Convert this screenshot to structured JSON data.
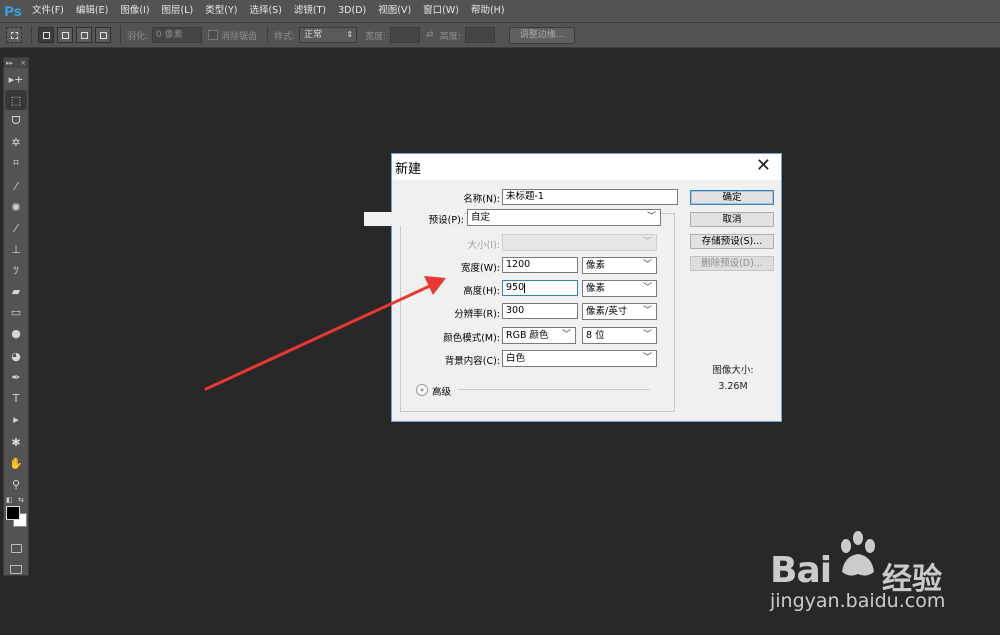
{
  "app": {
    "logo": "Ps",
    "menu": [
      "文件(F)",
      "编辑(E)",
      "图像(I)",
      "图层(L)",
      "类型(Y)",
      "选择(S)",
      "滤镜(T)",
      "3D(D)",
      "视图(V)",
      "窗口(W)",
      "帮助(H)"
    ]
  },
  "options_bar": {
    "feather_label": "羽化:",
    "feather_value": "0 像素",
    "antialias_label": "消除锯齿",
    "style_label": "样式:",
    "style_value": "正常",
    "width_label": "宽度:",
    "height_label": "高度:",
    "refine_edge_button": "调整边缘..."
  },
  "toolbar": {
    "header_left": "▸▸",
    "header_right": "×",
    "tools": [
      {
        "name": "move-tool-icon",
        "glyph": "▸+"
      },
      {
        "name": "marquee-tool-icon",
        "glyph": "⬚",
        "active": true
      },
      {
        "name": "lasso-tool-icon",
        "glyph": "ᗜ"
      },
      {
        "name": "magic-wand-tool-icon",
        "glyph": "✲"
      },
      {
        "name": "crop-tool-icon",
        "glyph": "⌗"
      },
      {
        "name": "eyedropper-tool-icon",
        "glyph": "⁄"
      },
      {
        "name": "healing-brush-tool-icon",
        "glyph": "✺"
      },
      {
        "name": "brush-tool-icon",
        "glyph": "⁄"
      },
      {
        "name": "clone-stamp-tool-icon",
        "glyph": "⊥"
      },
      {
        "name": "history-brush-tool-icon",
        "glyph": "ﾂ"
      },
      {
        "name": "eraser-tool-icon",
        "glyph": "▰"
      },
      {
        "name": "gradient-tool-icon",
        "glyph": "▭"
      },
      {
        "name": "blur-tool-icon",
        "glyph": "●"
      },
      {
        "name": "dodge-tool-icon",
        "glyph": "◕"
      },
      {
        "name": "pen-tool-icon",
        "glyph": "✒"
      },
      {
        "name": "type-tool-icon",
        "glyph": "T"
      },
      {
        "name": "path-selection-tool-icon",
        "glyph": "▸"
      },
      {
        "name": "custom-shape-tool-icon",
        "glyph": "✱"
      },
      {
        "name": "hand-tool-icon",
        "glyph": "✋"
      },
      {
        "name": "zoom-tool-icon",
        "glyph": "⚲"
      }
    ],
    "colors": {
      "foreground": "#000000",
      "background": "#ffffff"
    }
  },
  "dialog": {
    "title": "新建",
    "name_label": "名称(N):",
    "name_value": "未标题-1",
    "preset_label": "预设(P):",
    "preset_value": "自定",
    "size_label": "大小(I):",
    "size_value": "",
    "width_label": "宽度(W):",
    "width_value": "1200",
    "width_unit": "像素",
    "height_label": "高度(H):",
    "height_value": "950",
    "height_unit": "像素",
    "resolution_label": "分辨率(R):",
    "resolution_value": "300",
    "resolution_unit": "像素/英寸",
    "color_mode_label": "颜色模式(M):",
    "color_mode_value": "RGB 颜色",
    "bit_depth_value": "8 位",
    "background_label": "背景内容(C):",
    "background_value": "白色",
    "advanced_label": "高级",
    "ok_button": "确定",
    "cancel_button": "取消",
    "save_preset_button": "存储预设(S)...",
    "delete_preset_button": "删除预设(D)...",
    "image_size_label": "图像大小:",
    "image_size_value": "3.26M"
  },
  "watermark": {
    "brand_text": "Bai",
    "brand_suffix": "经验",
    "url": "jingyan.baidu.com"
  },
  "colors": {
    "workspace": "#282828",
    "panel": "#535353",
    "dialog_bg": "#f0f0f0",
    "annotation_arrow": "#e8382f",
    "ps_blue": "#31a8ff"
  }
}
